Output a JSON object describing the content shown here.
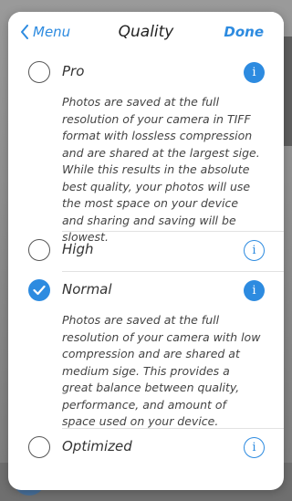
{
  "nav": {
    "back_label": "Menu",
    "title": "Quality",
    "done_label": "Done"
  },
  "options": [
    {
      "label": "Pro",
      "selected": false,
      "description": "Photos are saved at the full resolution of your camera in TIFF format with lossless compression and are shared at the largest sige. While this results in the absolute best quality, your photos will use the most space on your device and sharing and saving will be slowest."
    },
    {
      "label": "High",
      "selected": false,
      "description": ""
    },
    {
      "label": "Normal",
      "selected": true,
      "description": "Photos are saved at the full resolution of your camera with low compression and are shared at medium sige. This provides a great balance between quality, performance, and amount of space used on your device."
    },
    {
      "label": "Optimized",
      "selected": false,
      "description": ""
    }
  ],
  "colors": {
    "accent": "#2d8be0"
  }
}
